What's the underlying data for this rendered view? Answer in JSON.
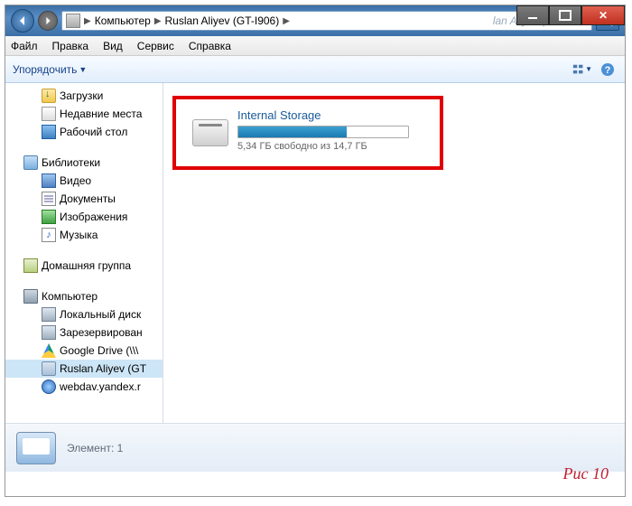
{
  "titlebar": {
    "min": "",
    "max": "",
    "close": ""
  },
  "address": {
    "crumb1": "Компьютер",
    "crumb2": "Ruslan Aliyev (GT-I906)",
    "hint": "lan Aliyev (GT-I906"
  },
  "menu": {
    "file": "Файл",
    "edit": "Правка",
    "view": "Вид",
    "tools": "Сервис",
    "help": "Справка"
  },
  "toolbar": {
    "organize": "Упорядочить"
  },
  "sidebar": {
    "downloads": "Загрузки",
    "recent": "Недавние места",
    "desktop": "Рабочий стол",
    "libraries": "Библиотеки",
    "video": "Видео",
    "documents": "Документы",
    "pictures": "Изображения",
    "music": "Музыка",
    "homegroup": "Домашняя группа",
    "computer": "Компьютер",
    "localdisk": "Локальный диск",
    "reserved": "Зарезервирован",
    "gdrive": "Google Drive (\\\\\\",
    "device": "Ruslan Aliyev (GT",
    "webdav": "webdav.yandex.r"
  },
  "storage": {
    "title": "Internal Storage",
    "subtitle": "5,34 ГБ свободно из 14,7 ГБ"
  },
  "detail": {
    "label": "Элемент: 1"
  },
  "caption": "Рис 10",
  "chart_data": {
    "type": "bar",
    "title": "Internal Storage",
    "categories": [
      "used",
      "free"
    ],
    "values": [
      9.36,
      5.34
    ],
    "total": 14.7,
    "unit": "ГБ",
    "fill_percent": 64
  }
}
